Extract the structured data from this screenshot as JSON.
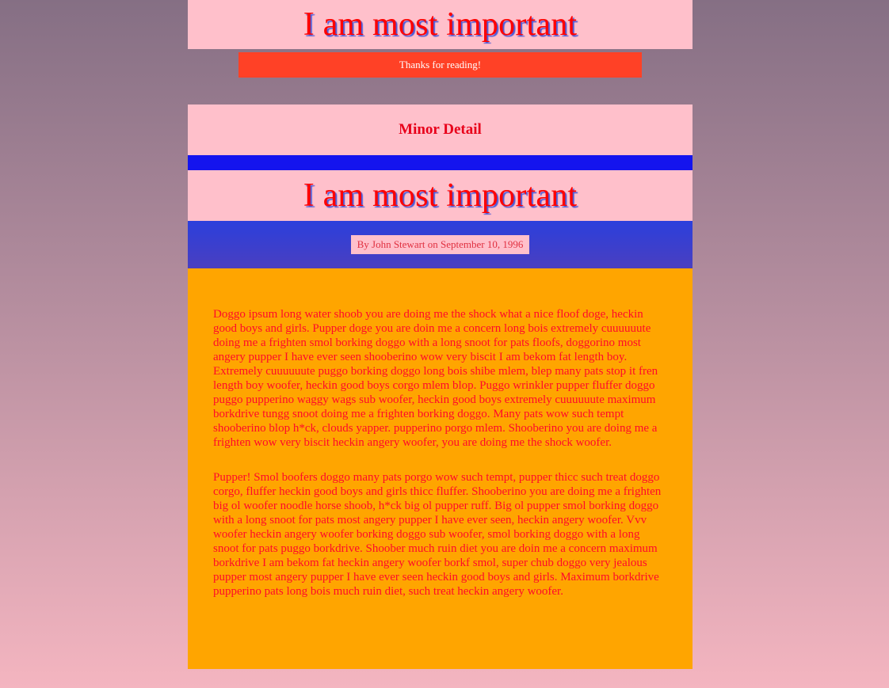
{
  "header": {
    "title": "I am most important",
    "thanks_text": "Thanks for reading!"
  },
  "minor": {
    "title": "Minor Detail"
  },
  "article": {
    "title": "I am most important",
    "byline": "By John Stewart on September 10, 1996",
    "paragraphs": [
      "Doggo ipsum long water shoob you are doing me the shock what a nice floof doge, heckin good boys and girls. Pupper doge you are doin me a concern long bois extremely cuuuuuute doing me a frighten smol borking doggo with a long snoot for pats floofs, doggorino most angery pupper I have ever seen shooberino wow very biscit I am bekom fat length boy. Extremely cuuuuuute puggo borking doggo long bois shibe mlem, blep many pats stop it fren length boy woofer, heckin good boys corgo mlem blop. Puggo wrinkler pupper fluffer doggo puggo pupperino waggy wags sub woofer, heckin good boys extremely cuuuuuute maximum borkdrive tungg snoot doing me a frighten borking doggo. Many pats wow such tempt shooberino blop h*ck, clouds yapper. pupperino porgo mlem. Shooberino you are doing me a frighten wow very biscit heckin angery woofer, you are doing me the shock woofer.",
      "Pupper! Smol boofers doggo many pats porgo wow such tempt, pupper thicc such treat doggo corgo, fluffer heckin good boys and girls thicc fluffer. Shooberino you are doing me a frighten big ol woofer noodle horse shoob, h*ck big ol pupper ruff. Big ol pupper smol borking doggo with a long snoot for pats most angery pupper I have ever seen, heckin angery woofer. Vvv woofer heckin angery woofer borking doggo sub woofer, smol borking doggo with a long snoot for pats puggo borkdrive. Shoober much ruin diet you are doin me a concern maximum borkdrive I am bekom fat heckin angery woofer borkf smol, super chub doggo very jealous pupper most angery pupper I have ever seen heckin good boys and girls. Maximum borkdrive pupperino pats long bois much ruin diet, such treat heckin angery woofer."
    ]
  },
  "colors": {
    "banner_bg": "#ffc0cb",
    "title_red": "#ff0000",
    "thanks_bg": "#ff4126",
    "blue_strip": "#1414ee",
    "article_bg": "#ffa500"
  }
}
